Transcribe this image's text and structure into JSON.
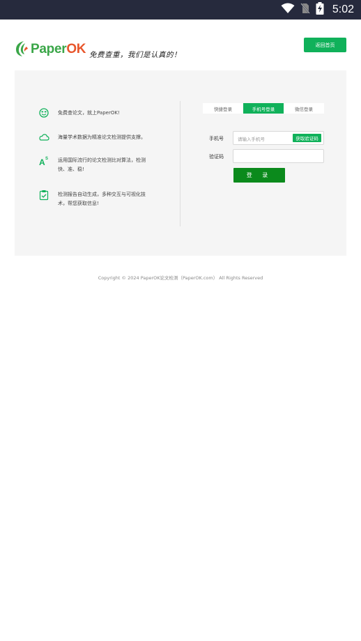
{
  "status_bar": {
    "time": "5:02",
    "icons": [
      "wifi-icon",
      "no-sim-icon",
      "battery-charging-icon"
    ]
  },
  "header": {
    "logo_main": "Paper",
    "logo_accent": "OK",
    "slogan": "免费查重，我们是认真的！",
    "back_button": "返回首页",
    "colors": {
      "brand_green": "#10b15a",
      "logo_green": "#3aa648",
      "logo_orange": "#e8562b"
    }
  },
  "features": [
    {
      "icon": "smile-icon",
      "text": "免费查论文，就上PaperOK!"
    },
    {
      "icon": "cloud-icon",
      "text": "海量学术数据为精准论文检测提供支撑。"
    },
    {
      "icon": "font-size-icon",
      "text": "运用国际流行的论文检测比对算法，检测快、准、稳!"
    },
    {
      "icon": "clipboard-check-icon",
      "text": "检测报告自动生成，多种交互与可视化技术，帮您获取信息!"
    }
  ],
  "login": {
    "tabs": [
      "快捷登录",
      "手机号登录",
      "微信登录"
    ],
    "active_tab": 1,
    "phone_label": "手机号",
    "phone_placeholder": "请输入手机号",
    "code_button": "获取验证码",
    "code_label": "验证码",
    "submit": "登 录"
  },
  "footer": {
    "copyright": "Copyright © 2024 PaperOK论文检测（PaperOK.com） All Rights Reserved"
  }
}
